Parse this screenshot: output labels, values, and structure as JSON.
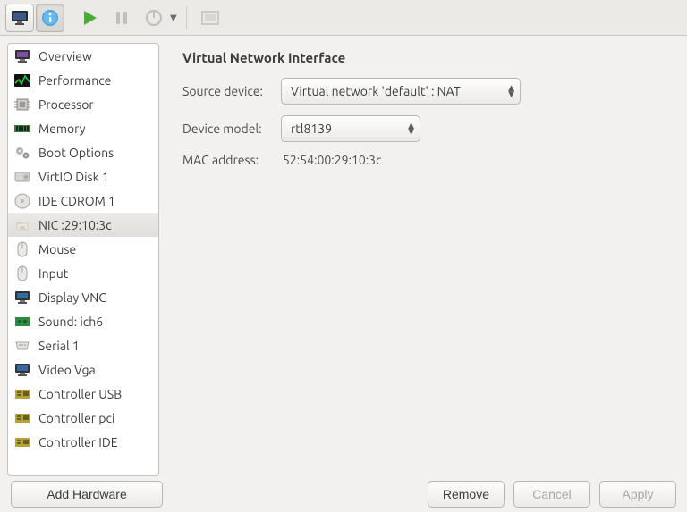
{
  "toolbar": {},
  "sidebar": {
    "items": [
      {
        "label": "Overview"
      },
      {
        "label": "Performance"
      },
      {
        "label": "Processor"
      },
      {
        "label": "Memory"
      },
      {
        "label": "Boot Options"
      },
      {
        "label": "VirtIO Disk 1"
      },
      {
        "label": "IDE CDROM 1"
      },
      {
        "label": "NIC :29:10:3c"
      },
      {
        "label": "Mouse"
      },
      {
        "label": "Input"
      },
      {
        "label": "Display VNC"
      },
      {
        "label": "Sound: ich6"
      },
      {
        "label": "Serial 1"
      },
      {
        "label": "Video Vga"
      },
      {
        "label": "Controller USB"
      },
      {
        "label": "Controller pci"
      },
      {
        "label": "Controller IDE"
      }
    ],
    "selected_index": 7,
    "add_hardware_label": "Add Hardware"
  },
  "panel": {
    "title": "Virtual Network Interface",
    "fields": {
      "source_device": {
        "label": "Source device:",
        "value": "Virtual network 'default' : NAT"
      },
      "device_model": {
        "label": "Device model:",
        "value": "rtl8139"
      },
      "mac_address": {
        "label": "MAC address:",
        "value": "52:54:00:29:10:3c"
      }
    }
  },
  "footer": {
    "remove_label": "Remove",
    "cancel_label": "Cancel",
    "apply_label": "Apply",
    "cancel_enabled": false,
    "apply_enabled": false
  }
}
